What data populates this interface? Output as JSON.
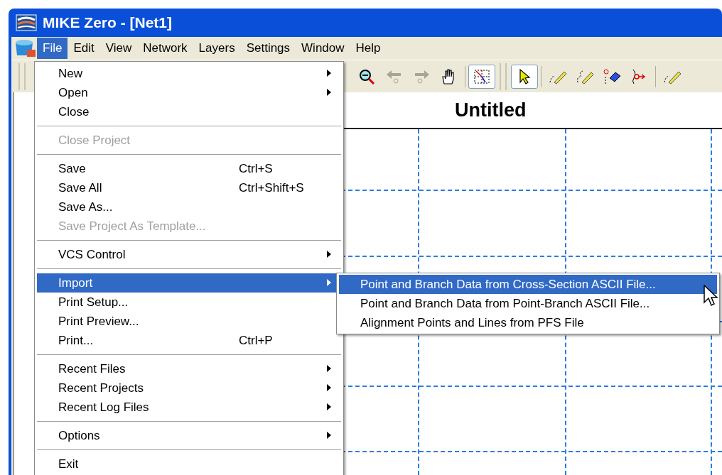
{
  "window": {
    "title": "MIKE Zero - [Net1]"
  },
  "menubar": [
    {
      "label": "File",
      "selected": true
    },
    {
      "label": "Edit",
      "selected": false
    },
    {
      "label": "View",
      "selected": false
    },
    {
      "label": "Network",
      "selected": false
    },
    {
      "label": "Layers",
      "selected": false
    },
    {
      "label": "Settings",
      "selected": false
    },
    {
      "label": "Window",
      "selected": false
    },
    {
      "label": "Help",
      "selected": false
    }
  ],
  "toolbar": [
    {
      "kind": "zoom-out"
    },
    {
      "kind": "back",
      "disabled": true
    },
    {
      "kind": "forward",
      "disabled": true
    },
    {
      "kind": "pan"
    },
    {
      "kind": "separator"
    },
    {
      "kind": "grid",
      "pressed": true
    },
    {
      "kind": "grip"
    },
    {
      "kind": "select",
      "pressed": true
    },
    {
      "kind": "separator"
    },
    {
      "kind": "draw-line"
    },
    {
      "kind": "draw-curve"
    },
    {
      "kind": "erase-point"
    },
    {
      "kind": "connect"
    },
    {
      "kind": "separator"
    },
    {
      "kind": "draw-line"
    }
  ],
  "canvas": {
    "title": "Untitled"
  },
  "file_menu": [
    {
      "kind": "item",
      "label": "New",
      "submenu": true,
      "disabled": false,
      "selected": false
    },
    {
      "kind": "item",
      "label": "Open",
      "submenu": true,
      "disabled": false,
      "selected": false
    },
    {
      "kind": "item",
      "label": "Close",
      "submenu": false,
      "disabled": false,
      "selected": false
    },
    {
      "kind": "separator"
    },
    {
      "kind": "item",
      "label": "Close Project",
      "submenu": false,
      "disabled": true,
      "selected": false
    },
    {
      "kind": "separator"
    },
    {
      "kind": "item",
      "label": "Save",
      "shortcut": "Ctrl+S",
      "submenu": false,
      "disabled": false,
      "selected": false
    },
    {
      "kind": "item",
      "label": "Save All",
      "shortcut": "Ctrl+Shift+S",
      "submenu": false,
      "disabled": false,
      "selected": false
    },
    {
      "kind": "item",
      "label": "Save As...",
      "submenu": false,
      "disabled": false,
      "selected": false
    },
    {
      "kind": "item",
      "label": "Save Project As Template...",
      "submenu": false,
      "disabled": true,
      "selected": false
    },
    {
      "kind": "separator"
    },
    {
      "kind": "item",
      "label": "VCS Control",
      "submenu": true,
      "disabled": false,
      "selected": false
    },
    {
      "kind": "separator"
    },
    {
      "kind": "item",
      "label": "Import",
      "submenu": true,
      "disabled": false,
      "selected": true
    },
    {
      "kind": "item",
      "label": "Print Setup...",
      "submenu": false,
      "disabled": false,
      "selected": false
    },
    {
      "kind": "item",
      "label": "Print Preview...",
      "submenu": false,
      "disabled": false,
      "selected": false
    },
    {
      "kind": "item",
      "label": "Print...",
      "shortcut": "Ctrl+P",
      "submenu": false,
      "disabled": false,
      "selected": false
    },
    {
      "kind": "separator"
    },
    {
      "kind": "item",
      "label": "Recent Files",
      "submenu": true,
      "disabled": false,
      "selected": false
    },
    {
      "kind": "item",
      "label": "Recent Projects",
      "submenu": true,
      "disabled": false,
      "selected": false
    },
    {
      "kind": "item",
      "label": "Recent Log Files",
      "submenu": true,
      "disabled": false,
      "selected": false
    },
    {
      "kind": "separator"
    },
    {
      "kind": "item",
      "label": "Options",
      "submenu": true,
      "disabled": false,
      "selected": false
    },
    {
      "kind": "separator"
    },
    {
      "kind": "item",
      "label": "Exit",
      "submenu": false,
      "disabled": false,
      "selected": false
    }
  ],
  "import_submenu": [
    {
      "label": "Point and Branch Data from Cross-Section ASCII File...",
      "selected": true
    },
    {
      "label": "Point and Branch Data from Point-Branch ASCII File...",
      "selected": false
    },
    {
      "label": "Alignment Points and Lines from PFS File",
      "selected": false
    }
  ]
}
